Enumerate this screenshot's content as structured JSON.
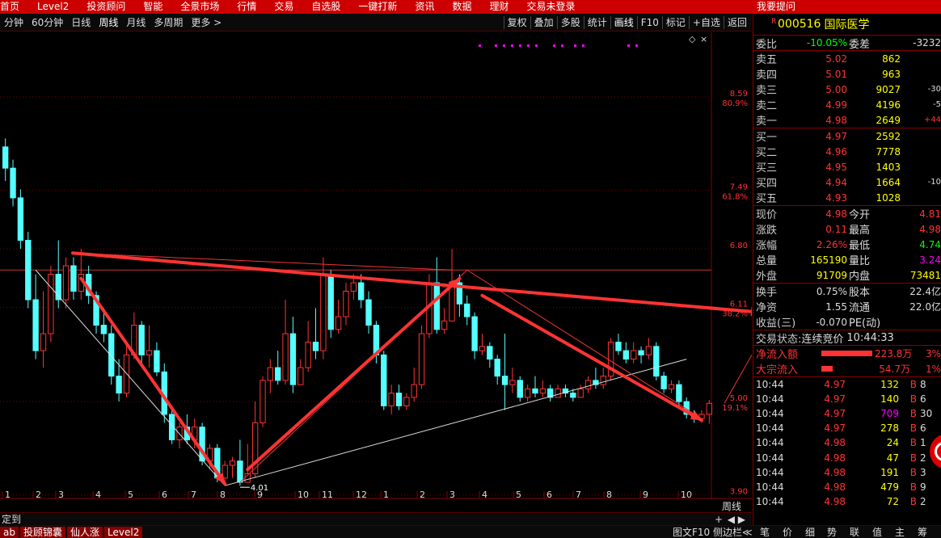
{
  "topbar": {
    "items": [
      "首页",
      "Level2",
      "投资顾问",
      "智能",
      "全景市场",
      "行情",
      "交易",
      "自选股",
      "一键打新",
      "资讯",
      "数据",
      "理财",
      "交易未登录"
    ],
    "right_text": "我要提问"
  },
  "toolbar": {
    "periods": [
      "分钟",
      "60分钟",
      "日线",
      "周线",
      "月线",
      "多周期",
      "更多 >"
    ],
    "active_period": "周线",
    "tools": [
      "复权",
      "叠加",
      "多股",
      "统计",
      "画线",
      "F10",
      "标记",
      "+自选",
      "返回"
    ],
    "active_tool": "画线"
  },
  "chart_data": {
    "type": "candlestick",
    "period": "周线",
    "ylim": [
      3.85,
      9.35
    ],
    "y_right_labels": [
      {
        "price": 8.59,
        "label": "8.59",
        "pct": "80.9%"
      },
      {
        "price": 7.49,
        "label": "7.49",
        "pct": "61.8%"
      },
      {
        "price": 6.8,
        "label": "6.80",
        "pct": ""
      },
      {
        "price": 6.11,
        "label": "6.11",
        "pct": "38.2%"
      },
      {
        "price": 5.0,
        "label": "5.00",
        "pct": "19.1%"
      },
      {
        "price": 3.9,
        "label": "3.90",
        "pct": ""
      }
    ],
    "x_labels": [
      "1",
      "2",
      "3",
      "4",
      "5",
      "6",
      "7",
      "8",
      "9",
      "10",
      "11",
      "12",
      "1",
      "2",
      "3",
      "4",
      "5",
      "6",
      "7",
      "8",
      "9",
      "10"
    ],
    "low_annotation": "4.01",
    "low_price": 4.01,
    "horizontal_line_price": 6.55,
    "candles": [
      [
        8.0,
        7.75,
        8.1,
        7.6
      ],
      [
        7.75,
        7.4,
        7.85,
        7.3
      ],
      [
        7.4,
        6.9,
        7.5,
        6.8
      ],
      [
        6.9,
        6.2,
        7.0,
        6.1
      ],
      [
        6.2,
        5.6,
        6.5,
        5.5
      ],
      [
        5.6,
        5.8,
        6.3,
        5.4
      ],
      [
        5.8,
        6.5,
        6.6,
        5.7
      ],
      [
        6.5,
        6.2,
        6.9,
        6.1
      ],
      [
        6.2,
        6.6,
        6.7,
        6.1
      ],
      [
        6.6,
        6.3,
        6.7,
        6.2
      ],
      [
        6.3,
        6.5,
        6.8,
        6.2
      ],
      [
        6.5,
        6.25,
        6.6,
        6.15
      ],
      [
        6.25,
        5.9,
        6.3,
        5.8
      ],
      [
        5.9,
        5.8,
        6.1,
        5.7
      ],
      [
        5.8,
        5.3,
        5.9,
        5.2
      ],
      [
        5.3,
        5.1,
        5.5,
        5.0
      ],
      [
        5.1,
        5.55,
        5.7,
        5.05
      ],
      [
        5.55,
        5.9,
        6.05,
        5.5
      ],
      [
        5.9,
        5.55,
        5.95,
        5.45
      ],
      [
        5.55,
        5.6,
        5.9,
        5.4
      ],
      [
        5.6,
        5.35,
        5.7,
        5.3
      ],
      [
        5.35,
        4.85,
        5.45,
        4.75
      ],
      [
        4.85,
        4.55,
        4.95,
        4.5
      ],
      [
        4.55,
        4.7,
        4.75,
        4.45
      ],
      [
        4.7,
        4.55,
        4.85,
        4.5
      ],
      [
        4.55,
        4.7,
        4.8,
        4.45
      ],
      [
        4.7,
        4.3,
        4.75,
        4.25
      ],
      [
        4.3,
        4.45,
        4.5,
        4.2
      ],
      [
        4.45,
        4.1,
        4.5,
        4.05
      ],
      [
        4.1,
        4.25,
        4.3,
        4.05
      ],
      [
        4.25,
        4.3,
        4.35,
        4.1
      ],
      [
        4.3,
        4.05,
        4.55,
        4.01
      ],
      [
        4.05,
        4.15,
        4.5,
        4.05
      ],
      [
        4.15,
        4.75,
        5.0,
        4.1
      ],
      [
        4.75,
        5.25,
        5.3,
        4.7
      ],
      [
        5.25,
        5.4,
        5.5,
        5.1
      ],
      [
        5.4,
        5.25,
        5.6,
        5.2
      ],
      [
        5.25,
        5.8,
        6.2,
        5.2
      ],
      [
        5.8,
        5.2,
        6.0,
        5.1
      ],
      [
        5.2,
        5.4,
        5.5,
        5.2
      ],
      [
        5.4,
        5.7,
        5.95,
        5.35
      ],
      [
        5.7,
        5.6,
        6.1,
        5.5
      ],
      [
        5.6,
        6.5,
        6.7,
        5.5
      ],
      [
        6.5,
        5.85,
        6.55,
        5.75
      ],
      [
        5.85,
        6.0,
        6.2,
        5.8
      ],
      [
        6.0,
        6.3,
        6.4,
        5.9
      ],
      [
        6.3,
        6.4,
        6.5,
        6.2
      ],
      [
        6.4,
        6.2,
        6.5,
        6.1
      ],
      [
        6.2,
        5.9,
        6.3,
        5.8
      ],
      [
        5.9,
        5.55,
        5.95,
        5.45
      ],
      [
        5.55,
        4.95,
        5.6,
        4.9
      ],
      [
        4.95,
        5.1,
        5.2,
        4.85
      ],
      [
        5.1,
        4.95,
        5.2,
        4.9
      ],
      [
        4.95,
        5.05,
        5.1,
        4.9
      ],
      [
        5.05,
        5.2,
        5.4,
        5.0
      ],
      [
        5.2,
        5.8,
        5.9,
        5.15
      ],
      [
        5.8,
        6.4,
        6.5,
        5.75
      ],
      [
        6.4,
        5.85,
        6.7,
        5.8
      ],
      [
        5.85,
        5.95,
        6.1,
        5.8
      ],
      [
        5.95,
        6.4,
        6.8,
        5.95
      ],
      [
        6.4,
        6.15,
        6.5,
        6.0
      ],
      [
        6.15,
        6.0,
        6.25,
        5.9
      ],
      [
        6.0,
        5.6,
        6.05,
        5.5
      ],
      [
        5.6,
        5.65,
        5.8,
        5.55
      ],
      [
        5.65,
        5.5,
        5.7,
        5.4
      ],
      [
        5.5,
        5.3,
        5.55,
        5.2
      ],
      [
        5.3,
        5.2,
        5.8,
        4.9
      ],
      [
        5.2,
        5.25,
        5.4,
        5.1
      ],
      [
        5.25,
        5.05,
        5.3,
        5.0
      ],
      [
        5.05,
        5.15,
        5.2,
        5.0
      ],
      [
        5.15,
        5.1,
        5.3,
        5.05
      ],
      [
        5.1,
        5.15,
        5.25,
        5.05
      ],
      [
        5.15,
        5.05,
        5.2,
        5.0
      ],
      [
        5.05,
        5.15,
        5.2,
        5.05
      ],
      [
        5.15,
        5.1,
        5.2,
        5.05
      ],
      [
        5.1,
        5.05,
        5.15,
        5.0
      ],
      [
        5.05,
        5.15,
        5.2,
        5.05
      ],
      [
        5.15,
        5.25,
        5.3,
        5.1
      ],
      [
        5.25,
        5.2,
        5.4,
        5.15
      ],
      [
        5.2,
        5.3,
        5.4,
        5.15
      ],
      [
        5.3,
        5.7,
        5.75,
        5.25
      ],
      [
        5.7,
        5.6,
        5.8,
        5.55
      ],
      [
        5.6,
        5.5,
        5.7,
        5.45
      ],
      [
        5.5,
        5.6,
        5.7,
        5.45
      ],
      [
        5.6,
        5.55,
        5.65,
        5.45
      ],
      [
        5.55,
        5.65,
        5.75,
        5.5
      ],
      [
        5.65,
        5.3,
        5.7,
        5.25
      ],
      [
        5.3,
        5.15,
        5.35,
        5.1
      ],
      [
        5.15,
        5.2,
        5.25,
        5.1
      ],
      [
        5.2,
        5.0,
        5.25,
        4.95
      ],
      [
        5.0,
        4.85,
        5.05,
        4.8
      ],
      [
        4.85,
        4.8,
        4.9,
        4.75
      ],
      [
        4.8,
        4.85,
        4.9,
        4.75
      ],
      [
        4.85,
        4.98,
        5.02,
        4.74
      ]
    ]
  },
  "stock": {
    "r_mark": "R",
    "code": "000516",
    "name": "国际医学"
  },
  "weibi": {
    "label": "委比",
    "value": "-10.05%",
    "label2": "委差",
    "value2": "-3232"
  },
  "sell": [
    {
      "label": "卖五",
      "price": "5.02",
      "vol": "862",
      "chg": ""
    },
    {
      "label": "卖四",
      "price": "5.01",
      "vol": "963",
      "chg": ""
    },
    {
      "label": "卖三",
      "price": "5.00",
      "vol": "9027",
      "chg": "-30"
    },
    {
      "label": "卖二",
      "price": "4.99",
      "vol": "4196",
      "chg": "-5"
    },
    {
      "label": "卖一",
      "price": "4.98",
      "vol": "2649",
      "chg": "+44"
    }
  ],
  "buy": [
    {
      "label": "买一",
      "price": "4.97",
      "vol": "2592",
      "chg": ""
    },
    {
      "label": "买二",
      "price": "4.96",
      "vol": "7778",
      "chg": ""
    },
    {
      "label": "买三",
      "price": "4.95",
      "vol": "1403",
      "chg": ""
    },
    {
      "label": "买四",
      "price": "4.94",
      "vol": "1664",
      "chg": "-10"
    },
    {
      "label": "买五",
      "price": "4.93",
      "vol": "1028",
      "chg": ""
    }
  ],
  "quote": [
    {
      "l1": "现价",
      "v1": "4.98",
      "l2": "今开",
      "v2": "4.81"
    },
    {
      "l1": "涨跌",
      "v1": "0.11",
      "l2": "最高",
      "v2": "4.98"
    },
    {
      "l1": "涨幅",
      "v1": "2.26%",
      "l2": "最低",
      "v2": "4.74"
    },
    {
      "l1": "总量",
      "v1": "165190",
      "l2": "量比",
      "v2": "3.24"
    },
    {
      "l1": "外盘",
      "v1": "91709",
      "l2": "内盘",
      "v2": "73481"
    }
  ],
  "fund": [
    {
      "l1": "换手",
      "v1": "0.75%",
      "l2": "股本",
      "v2": "22.4亿"
    },
    {
      "l1": "净资",
      "v1": "1.55",
      "l2": "流通",
      "v2": "22.0亿"
    },
    {
      "l1": "收益(三)",
      "v1": "-0.070",
      "l2": "PE(动)",
      "v2": ""
    }
  ],
  "trade_status": {
    "label": "交易状态:",
    "value": "连续竞价",
    "time": "10:44:33"
  },
  "flows": [
    {
      "label": "净流入额",
      "value": "223.8万",
      "pct": "3%",
      "bar": 0.9
    },
    {
      "label": "大宗流入",
      "value": "54.7万",
      "pct": "1%",
      "bar": 0.2
    }
  ],
  "ticks": [
    {
      "time": "10:44",
      "price": "4.97",
      "vol": "132",
      "side": "B",
      "n": "8"
    },
    {
      "time": "10:44",
      "price": "4.97",
      "vol": "140",
      "side": "B",
      "n": "6"
    },
    {
      "time": "10:44",
      "price": "4.97",
      "vol": "709",
      "side": "B",
      "n": "30"
    },
    {
      "time": "10:44",
      "price": "4.97",
      "vol": "278",
      "side": "B",
      "n": "6"
    },
    {
      "time": "10:44",
      "price": "4.98",
      "vol": "24",
      "side": "B",
      "n": "1"
    },
    {
      "time": "10:44",
      "price": "4.98",
      "vol": "47",
      "side": "B",
      "n": "2"
    },
    {
      "time": "10:44",
      "price": "4.98",
      "vol": "191",
      "side": "B",
      "n": "3"
    },
    {
      "time": "10:44",
      "price": "4.98",
      "vol": "479",
      "side": "B",
      "n": "9"
    },
    {
      "time": "10:44",
      "price": "4.98",
      "vol": "72",
      "side": "B",
      "n": "2"
    }
  ],
  "status": {
    "left": "定到",
    "plus": "+",
    "nav": "◀ ▶",
    "period_tag": "周线"
  },
  "bottom": {
    "tabs": [
      "ab",
      "投顾锦囊",
      "仙人涨",
      "Level2"
    ],
    "right_tabs": [
      "图文F10",
      "侧边栏≪",
      "笔",
      "价",
      "细",
      "势",
      "联",
      "值",
      "主",
      "筹"
    ]
  },
  "colors": {
    "up": "#ff3333",
    "down": "#54ffff",
    "accent": "#cc0000"
  }
}
